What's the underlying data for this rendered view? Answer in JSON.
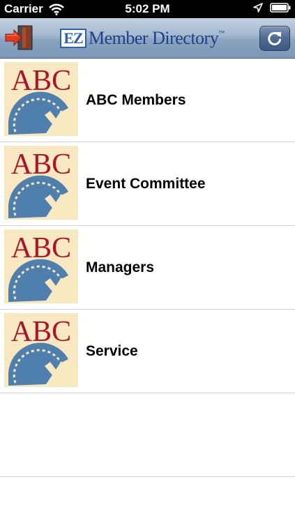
{
  "status_bar": {
    "carrier": "Carrier",
    "time": "5:02 PM",
    "icons": [
      "wifi-icon",
      "location-icon",
      "battery-icon"
    ]
  },
  "nav_bar": {
    "logo_ez": "EZ",
    "logo_text": "Member Directory",
    "logo_tm": "™",
    "left_button_icon": "exit-door-icon",
    "right_button_icon": "refresh-icon"
  },
  "list": {
    "thumbnail_text": "ABC",
    "items": [
      {
        "label": "ABC Members"
      },
      {
        "label": "Event Committee"
      },
      {
        "label": "Managers"
      },
      {
        "label": "Service"
      }
    ]
  },
  "colors": {
    "nav_gradient_top": "#c3d2e2",
    "nav_gradient_bottom": "#7b97b7",
    "logo_blue": "#1e3f8a",
    "abc_red": "#b0122a",
    "thumb_bg": "#f7e8bf",
    "saw_blue": "#4f7fad"
  }
}
